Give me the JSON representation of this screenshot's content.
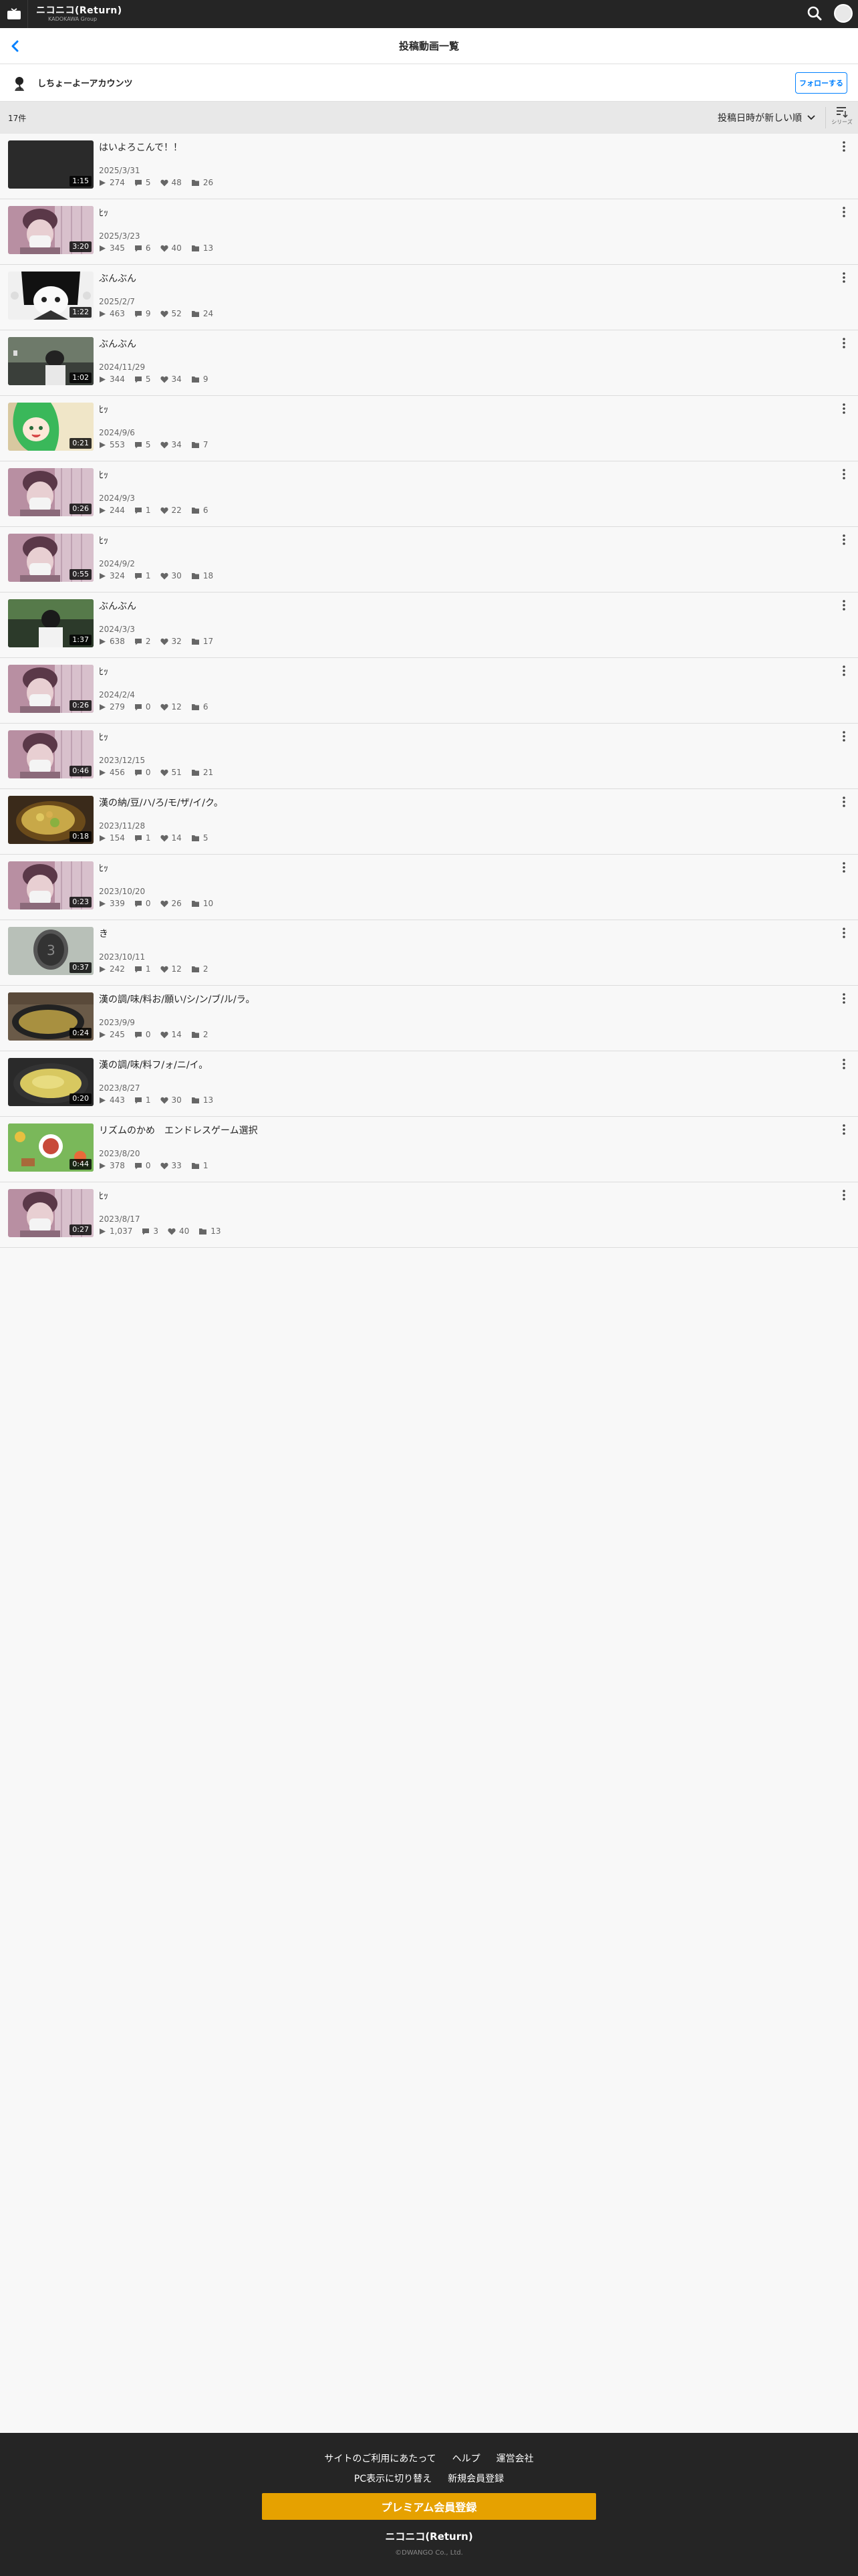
{
  "header": {
    "logo_main": "ニコニコ(Return)",
    "logo_sub": "KADOKAWA Group"
  },
  "titlebar": {
    "title": "投稿動画一覧"
  },
  "user": {
    "name": "しちょーよーアカウンツ",
    "follow_label": "フォローする"
  },
  "sortbar": {
    "count": "17件",
    "sort_label": "投稿日時が新しい順",
    "series_label": "シリーズ"
  },
  "videos": [
    {
      "title": "はいよろこんで！！",
      "date": "2025/3/31",
      "views": "274",
      "comments": "5",
      "likes": "48",
      "mylists": "26",
      "duration": "1:15",
      "thumb": "dark"
    },
    {
      "title": "ﾋｯ",
      "date": "2025/3/23",
      "views": "345",
      "comments": "6",
      "likes": "40",
      "mylists": "13",
      "duration": "3:20",
      "thumb": "face"
    },
    {
      "title": "ぶんぶん",
      "date": "2025/2/7",
      "views": "463",
      "comments": "9",
      "likes": "52",
      "mylists": "24",
      "duration": "1:22",
      "thumb": "anime"
    },
    {
      "title": "ぶんぶん",
      "date": "2024/11/29",
      "views": "344",
      "comments": "5",
      "likes": "34",
      "mylists": "9",
      "duration": "1:02",
      "thumb": "room"
    },
    {
      "title": "ﾋｯ",
      "date": "2024/9/6",
      "views": "553",
      "comments": "5",
      "likes": "34",
      "mylists": "7",
      "duration": "0:21",
      "thumb": "green"
    },
    {
      "title": "ﾋｯ",
      "date": "2024/9/3",
      "views": "244",
      "comments": "1",
      "likes": "22",
      "mylists": "6",
      "duration": "0:26",
      "thumb": "face"
    },
    {
      "title": "ﾋｯ",
      "date": "2024/9/2",
      "views": "324",
      "comments": "1",
      "likes": "30",
      "mylists": "18",
      "duration": "0:55",
      "thumb": "face"
    },
    {
      "title": "ぶんぶん",
      "date": "2024/3/3",
      "views": "638",
      "comments": "2",
      "likes": "32",
      "mylists": "17",
      "duration": "1:37",
      "thumb": "outdoor"
    },
    {
      "title": "ﾋｯ",
      "date": "2024/2/4",
      "views": "279",
      "comments": "0",
      "likes": "12",
      "mylists": "6",
      "duration": "0:26",
      "thumb": "face"
    },
    {
      "title": "ﾋｯ",
      "date": "2023/12/15",
      "views": "456",
      "comments": "0",
      "likes": "51",
      "mylists": "21",
      "duration": "0:46",
      "thumb": "face"
    },
    {
      "title": "漢の納/豆/ハ/ろ/モ/ザ/イ/ク。",
      "date": "2023/11/28",
      "views": "154",
      "comments": "1",
      "likes": "14",
      "mylists": "5",
      "duration": "0:18",
      "thumb": "food"
    },
    {
      "title": "ﾋｯ",
      "date": "2023/10/20",
      "views": "339",
      "comments": "0",
      "likes": "26",
      "mylists": "10",
      "duration": "0:23",
      "thumb": "face"
    },
    {
      "title": "き",
      "date": "2023/10/11",
      "views": "242",
      "comments": "1",
      "likes": "12",
      "mylists": "2",
      "duration": "0:37",
      "thumb": "gray"
    },
    {
      "title": "漢の調/味/料お/願い/シ/ン/ブ/ル/ラ。",
      "date": "2023/9/9",
      "views": "245",
      "comments": "0",
      "likes": "14",
      "mylists": "2",
      "duration": "0:24",
      "thumb": "pan"
    },
    {
      "title": "漢の調/味/料フ/ォ/ニ/イ。",
      "date": "2023/8/27",
      "views": "443",
      "comments": "1",
      "likes": "30",
      "mylists": "13",
      "duration": "0:20",
      "thumb": "yellowpan"
    },
    {
      "title": "リズムのかめ　エンドレスゲーム選択",
      "date": "2023/8/20",
      "views": "378",
      "comments": "0",
      "likes": "33",
      "mylists": "1",
      "duration": "0:44",
      "thumb": "game"
    },
    {
      "title": "ﾋｯ",
      "date": "2023/8/17",
      "views": "1,037",
      "comments": "3",
      "likes": "40",
      "mylists": "13",
      "duration": "0:27",
      "thumb": "face"
    }
  ],
  "footer": {
    "links1": [
      "サイトのご利用にあたって",
      "ヘルプ",
      "運営会社"
    ],
    "links2": [
      "PC表示に切り替え",
      "新規会員登録"
    ],
    "premium_label": "プレミアム会員登録",
    "logo": "ニコニコ(Return)",
    "copyright": "©DWANGO Co., Ltd."
  },
  "colors": {
    "accent": "#0080ff",
    "premium": "#e6a100",
    "header_bg": "#252525"
  }
}
